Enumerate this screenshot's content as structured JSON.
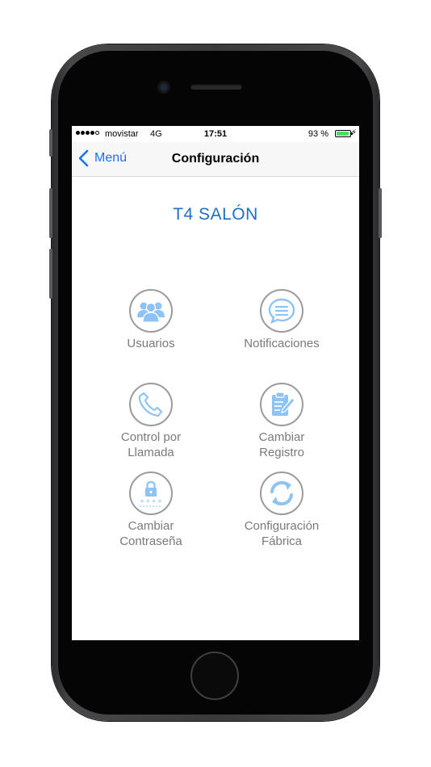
{
  "status_bar": {
    "carrier": "movistar",
    "network": "4G",
    "time": "17:51",
    "battery_percent": "93 %",
    "battery_level": 0.93,
    "charging_icon": "bolt-icon",
    "signal_icon": "signal-dots-icon"
  },
  "nav": {
    "back_label": "Menú",
    "title": "Configuración"
  },
  "device_name": "T4 SALÓN",
  "tiles": [
    {
      "line1": "Usuarios",
      "line2": "",
      "icon": "users-icon"
    },
    {
      "line1": "Notificaciones",
      "line2": "",
      "icon": "chat-bubble-icon"
    },
    {
      "line1": "Control por",
      "line2": "Llamada",
      "icon": "phone-icon"
    },
    {
      "line1": "Cambiar",
      "line2": "Registro",
      "icon": "clipboard-edit-icon"
    },
    {
      "line1": "Cambiar",
      "line2": "Contraseña",
      "icon": "password-lock-icon"
    },
    {
      "line1": "Configuración",
      "line2": "Fábrica",
      "icon": "refresh-icon"
    }
  ],
  "colors": {
    "accent": "#1a73e8",
    "title_blue": "#1f6fc0",
    "icon_blue": "#8ec3f5",
    "label_gray": "#7a7a7a",
    "battery_green": "#4cd964"
  }
}
